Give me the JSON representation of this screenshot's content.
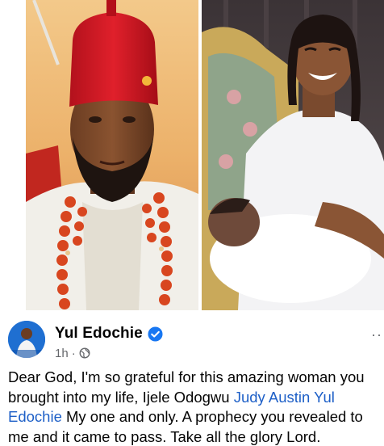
{
  "post": {
    "author": "Yul Edochie",
    "time": "1h",
    "separator": "·",
    "audience_icon": "globe-icon",
    "verified_icon": "verified-badge-icon",
    "more_icon": "more-options-icon",
    "more_label": "··",
    "text_start": "Dear God, I'm so grateful for this amazing woman you brought into my life, Ijele Odogwu ",
    "mention": "Judy Austin Yul Edochie",
    "text_end": " My one and only. A prophecy you revealed to me and it came to pass. Take all the glory Lord."
  },
  "colors": {
    "mention": "#1d5fc7",
    "verified": "#1877f2",
    "meta": "#65676b"
  }
}
